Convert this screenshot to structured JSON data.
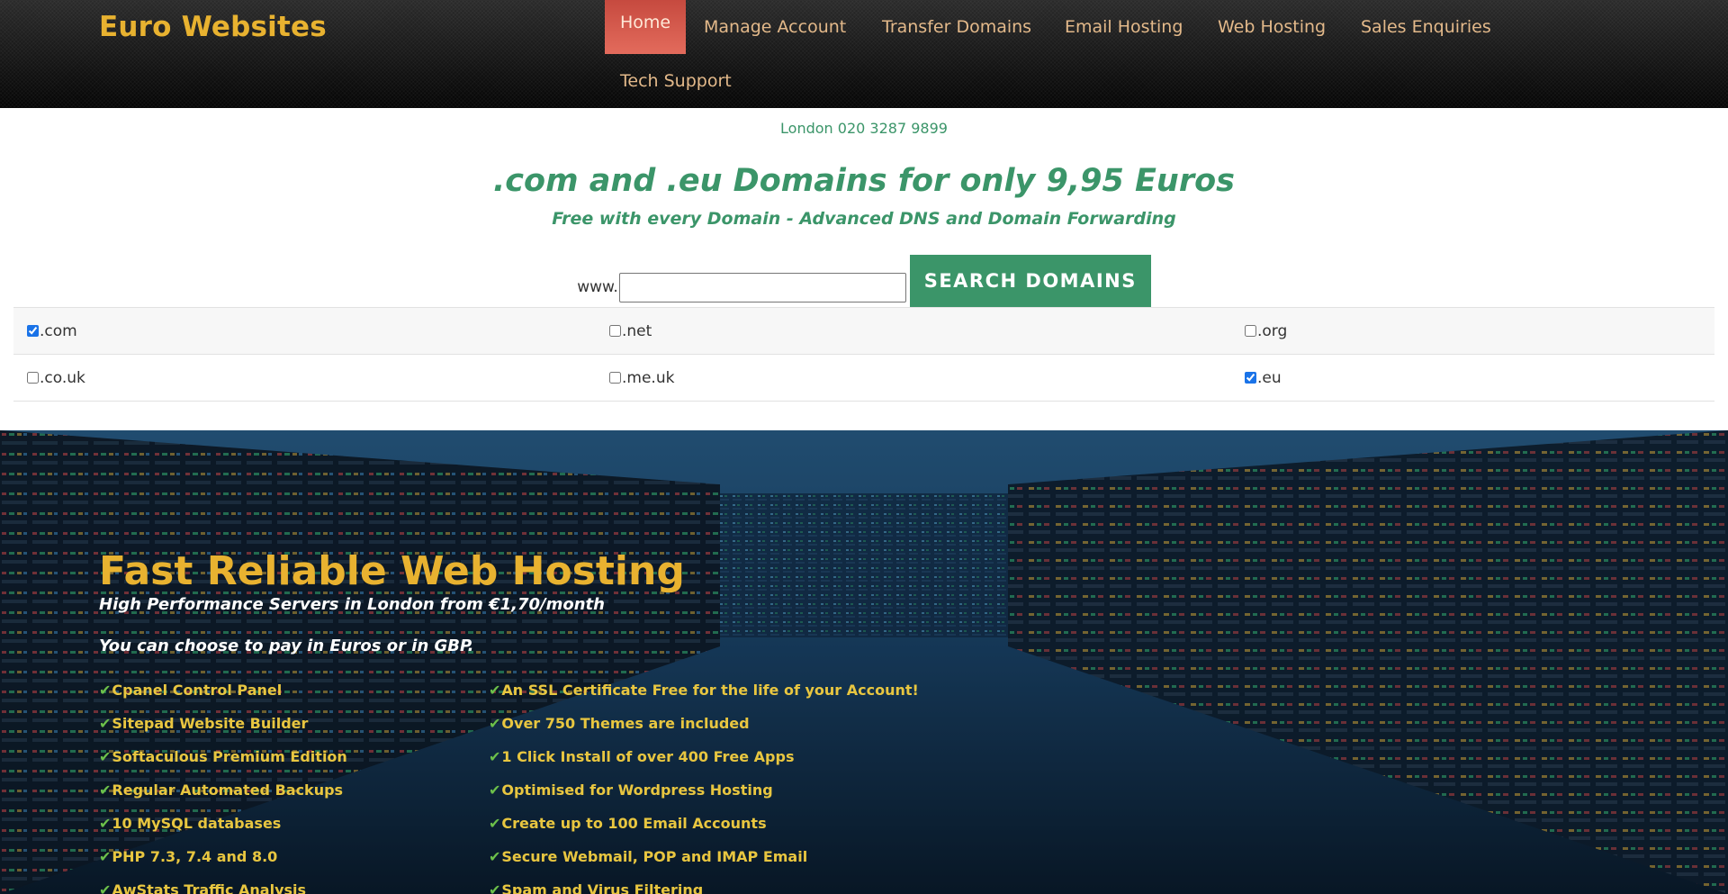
{
  "header": {
    "logo": "Euro Websites",
    "nav": [
      {
        "label": "Home",
        "active": true
      },
      {
        "label": "Manage Account"
      },
      {
        "label": "Transfer Domains"
      },
      {
        "label": "Email Hosting"
      },
      {
        "label": "Web Hosting"
      },
      {
        "label": "Sales Enquiries"
      },
      {
        "label": "Tech Support"
      }
    ]
  },
  "domain_search": {
    "phone": "London 020 3287 9899",
    "headline": ".com and .eu Domains for only 9,95 Euros",
    "subhead": "Free with every Domain - Advanced DNS and Domain Forwarding",
    "www_label": "www.",
    "input_value": "",
    "button_label": "Search Domains",
    "tlds": [
      {
        "label": ".com",
        "checked": true
      },
      {
        "label": ".net",
        "checked": false
      },
      {
        "label": ".org",
        "checked": false
      },
      {
        "label": ".co.uk",
        "checked": false
      },
      {
        "label": ".me.uk",
        "checked": false
      },
      {
        "label": ".eu",
        "checked": true
      }
    ]
  },
  "hosting": {
    "title": "Fast Reliable Web Hosting",
    "subtitle": "High Performance Servers in London from €1,70/month",
    "pay_note": "You can choose to pay in Euros or in GBP.",
    "features_left": [
      "Cpanel Control Panel",
      "Sitepad Website Builder",
      "Softaculous Premium Edition",
      "Regular Automated Backups",
      "10 MySQL databases",
      "PHP 7.3, 7.4 and 8.0",
      "AwStats Traffic Analysis"
    ],
    "features_right": [
      "An SSL Certificate Free for the life of your Account!",
      "Over 750 Themes are included",
      "1 Click Install of over 400 Free Apps",
      "Optimised for Wordpress Hosting",
      "Create up to 100 Email Accounts",
      "Secure Webmail, POP and IMAP Email",
      "Spam and Virus Filtering"
    ],
    "check_icon": "check-icon"
  },
  "colors": {
    "brand_gold": "#e8b230",
    "brand_green": "#3b9569",
    "nav_active": "#d9584b",
    "check_green": "#6cc04a"
  }
}
